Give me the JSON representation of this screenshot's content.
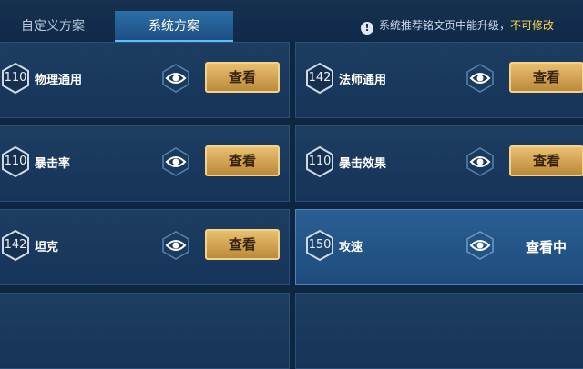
{
  "tabs": [
    {
      "label": "自定义方案"
    },
    {
      "label": "系统方案"
    }
  ],
  "notice": {
    "icon": "exclamation-icon",
    "text": "系统推荐铭文页中能升级，",
    "highlight": "不可修改"
  },
  "plans": [
    {
      "level": "110",
      "name": "物理通用",
      "action": "查看"
    },
    {
      "level": "142",
      "name": "法师通用",
      "action": "查看"
    },
    {
      "level": "110",
      "name": "暴击率",
      "action": "查看"
    },
    {
      "level": "110",
      "name": "暴击效果",
      "action": "查看"
    },
    {
      "level": "142",
      "name": "坦克",
      "action": "查看"
    },
    {
      "level": "150",
      "name": "攻速",
      "action": "查看中"
    }
  ],
  "colors": {
    "accent": "#5cc0ff",
    "gold_button": "#e9bf70",
    "highlight": "#ffd34d"
  }
}
